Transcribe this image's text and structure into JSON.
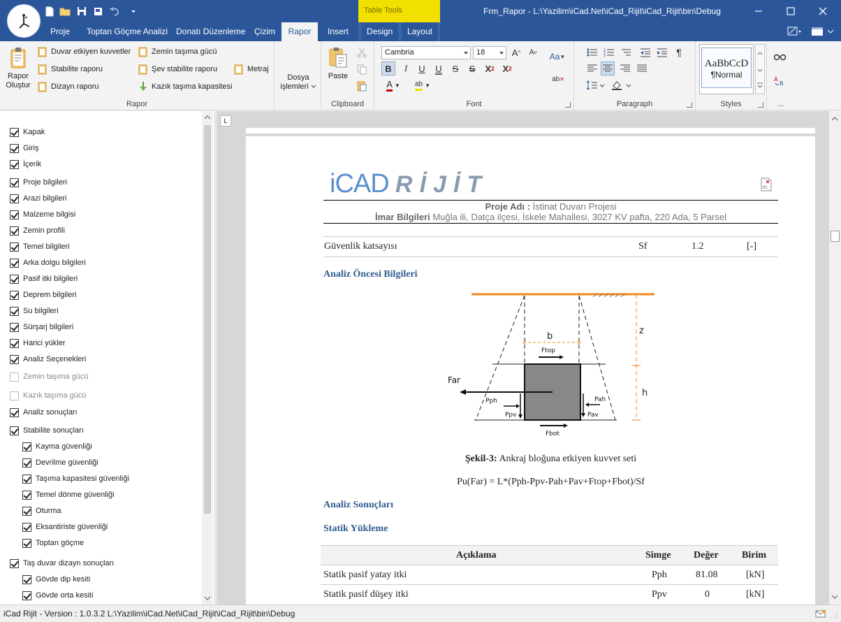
{
  "titlebar": {
    "window_title": "Frm_Rapor - L:\\Yazilim\\iCad.Net\\iCad_Rijit\\iCad_Rijit\\bin\\Debug",
    "context_tab_group": "Table Tools"
  },
  "tabs": [
    "Proje",
    "Toptan Göçme Analizi",
    "Donatı Düzenleme",
    "Çizim",
    "Rapor",
    "Insert",
    "Design",
    "Layout"
  ],
  "active_tab": "Rapor",
  "ribbon": {
    "rapor_group": {
      "label": "Rapor",
      "big_button": "Rapor\nOluştur",
      "items_col1": [
        "Duvar etkiyen kuvvetler",
        "Stabilite raporu",
        "Dizayn raporu"
      ],
      "items_col2": [
        "Zemin taşıma gücü",
        "Şev stabilite raporu",
        "Kazık taşıma kapasitesi"
      ],
      "items_col3": [
        "Metraj"
      ]
    },
    "dosya_group": {
      "label": "Dosya\nişlemleri"
    },
    "clipboard_group": {
      "label": "Clipboard",
      "paste": "Paste"
    },
    "font_group": {
      "label": "Font",
      "font_name": "Cambria",
      "font_size": "18"
    },
    "paragraph_group": {
      "label": "Paragraph"
    },
    "styles_group": {
      "label": "Styles",
      "style_preview": "AaBbCcD",
      "style_name": "¶Normal"
    },
    "more_group": {
      "label": "..."
    }
  },
  "left_pane": {
    "items": [
      {
        "label": "Kapak",
        "checked": true,
        "enabled": true,
        "indent": 0
      },
      {
        "label": "Giriş",
        "checked": true,
        "enabled": true,
        "indent": 0
      },
      {
        "label": "İçerik",
        "checked": true,
        "enabled": true,
        "indent": 0
      },
      {
        "label": "Proje bilgileri",
        "checked": true,
        "enabled": true,
        "indent": 0
      },
      {
        "label": "Arazi bilgileri",
        "checked": true,
        "enabled": true,
        "indent": 0
      },
      {
        "label": "Malzeme bilgisi",
        "checked": true,
        "enabled": true,
        "indent": 0
      },
      {
        "label": "Zemin profili",
        "checked": true,
        "enabled": true,
        "indent": 0
      },
      {
        "label": "Temel bilgileri",
        "checked": true,
        "enabled": true,
        "indent": 0
      },
      {
        "label": "Arka dolgu bilgileri",
        "checked": true,
        "enabled": true,
        "indent": 0
      },
      {
        "label": "Pasif itki bilgileri",
        "checked": true,
        "enabled": true,
        "indent": 0
      },
      {
        "label": "Deprem bilgileri",
        "checked": true,
        "enabled": true,
        "indent": 0
      },
      {
        "label": "Su bilgileri",
        "checked": true,
        "enabled": true,
        "indent": 0
      },
      {
        "label": "Sürşarj bilgileri",
        "checked": true,
        "enabled": true,
        "indent": 0
      },
      {
        "label": "Harici yükler",
        "checked": true,
        "enabled": true,
        "indent": 0
      },
      {
        "label": "Analiz Seçenekleri",
        "checked": true,
        "enabled": true,
        "indent": 0
      },
      {
        "label": "Zemin taşıma gücü",
        "checked": false,
        "enabled": false,
        "indent": 0
      },
      {
        "label": "Kazık taşıma gücü",
        "checked": false,
        "enabled": false,
        "indent": 0
      },
      {
        "label": "Analiz sonuçları",
        "checked": true,
        "enabled": true,
        "indent": 0
      },
      {
        "label": "Stabilite sonuçları",
        "checked": true,
        "enabled": true,
        "indent": 0
      },
      {
        "label": "Kayma güvenliği",
        "checked": true,
        "enabled": true,
        "indent": 1
      },
      {
        "label": "Devrilme güvenliği",
        "checked": true,
        "enabled": true,
        "indent": 1
      },
      {
        "label": "Taşıma kapasitesi güvenliği",
        "checked": true,
        "enabled": true,
        "indent": 1
      },
      {
        "label": "Temel dönme güvenliği",
        "checked": true,
        "enabled": true,
        "indent": 1
      },
      {
        "label": "Oturma",
        "checked": true,
        "enabled": true,
        "indent": 1
      },
      {
        "label": "Eksantiriste güvenliği",
        "checked": true,
        "enabled": true,
        "indent": 1
      },
      {
        "label": "Toptan göçme",
        "checked": true,
        "enabled": true,
        "indent": 1
      },
      {
        "label": "Taş duvar dizayn sonuçları",
        "checked": true,
        "enabled": true,
        "indent": 0
      },
      {
        "label": "Gövde dip kesiti",
        "checked": true,
        "enabled": true,
        "indent": 1
      },
      {
        "label": "Gövde orta kesiti",
        "checked": true,
        "enabled": true,
        "indent": 1
      }
    ]
  },
  "document": {
    "logo_text_1": "iCAD",
    "logo_text_2": "RİJİT",
    "project_label": "Proje Adı :",
    "project_value": "İstinat Duvarı Projesi",
    "imar_label": "İmar Bilgileri",
    "imar_value": "Muğla ili, Datça ilçesi, İskele Mahallesi, 3027 KV pafta, 220 Ada, 5 Parsel",
    "safety_row": {
      "desc": "Güvenlik katsayısı",
      "symbol": "Sf",
      "value": "1.2",
      "unit": "[-]"
    },
    "heading_pre_analysis": "Analiz Öncesi Bilgileri",
    "figure_labels": {
      "b": "b",
      "z": "z",
      "h": "h",
      "Far": "Far",
      "Ftop": "Ftop",
      "Fbot": "Fbot",
      "Pph": "Pph",
      "Ppv": "Ppv",
      "Pah": "Pah",
      "Pav": "Pav"
    },
    "caption_bold": "Şekil-3:",
    "caption_text": "Ankraj bloğuna etkiyen kuvvet seti",
    "formula": "Pu(Far) = L*(Pph-Ppv-Pah+Pav+Ftop+Fbot)/Sf",
    "heading_results": "Analiz Sonuçları",
    "heading_static": "Statik Yükleme",
    "table": {
      "headers": [
        "Açıklama",
        "Simge",
        "Değer",
        "Birim"
      ],
      "rows": [
        [
          "Statik pasif yatay itki",
          "Pph",
          "81.08",
          "[kN]"
        ],
        [
          "Statik pasif düşey itki",
          "Ppv",
          "0",
          "[kN]"
        ]
      ]
    }
  },
  "statusbar": {
    "text": "iCad Rijit - Version : 1.0.3.2  L:\\Yazilim\\iCad.Net\\iCad_Rijit\\iCad_Rijit\\bin\\Debug"
  }
}
